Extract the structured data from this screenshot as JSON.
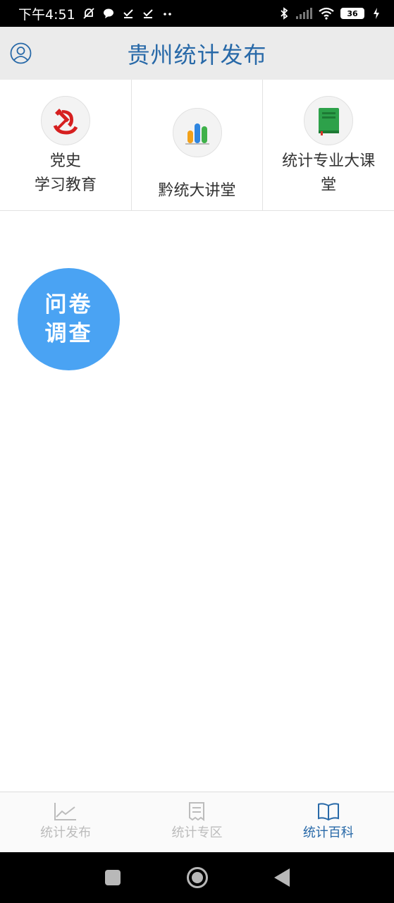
{
  "status_bar": {
    "time": "下午4:51",
    "battery": "36",
    "icons": [
      "mute-icon",
      "chat-bubble-icon",
      "check-icon",
      "check-icon",
      "more-dots-icon",
      "bluetooth-icon",
      "signal-icon",
      "wifi-icon",
      "battery-icon",
      "charging-icon"
    ]
  },
  "header": {
    "title": "贵州统计发布",
    "user_icon": "user-icon"
  },
  "menu": {
    "items": [
      {
        "line1": "党史",
        "line2": "学习教育",
        "icon": "party-emblem-icon"
      },
      {
        "line1": "",
        "line2": "黔统大讲堂",
        "icon": "bar-chart-icon"
      },
      {
        "line1": "统计专业大课",
        "line2": "堂",
        "icon": "book-icon"
      }
    ]
  },
  "survey_button": {
    "line1": "问卷",
    "line2": "调查",
    "color": "#4aa3f3"
  },
  "tabs": [
    {
      "label": "统计发布",
      "icon": "line-chart-icon",
      "active": false
    },
    {
      "label": "统计专区",
      "icon": "receipt-icon",
      "active": false
    },
    {
      "label": "统计百科",
      "icon": "open-book-icon",
      "active": true
    }
  ],
  "colors": {
    "accent": "#2869a8",
    "header_bg": "#ebebeb",
    "inactive_tab": "#bcbcbc"
  },
  "nav_bar": {
    "buttons": [
      "recent-apps-icon",
      "home-icon",
      "back-icon"
    ]
  }
}
